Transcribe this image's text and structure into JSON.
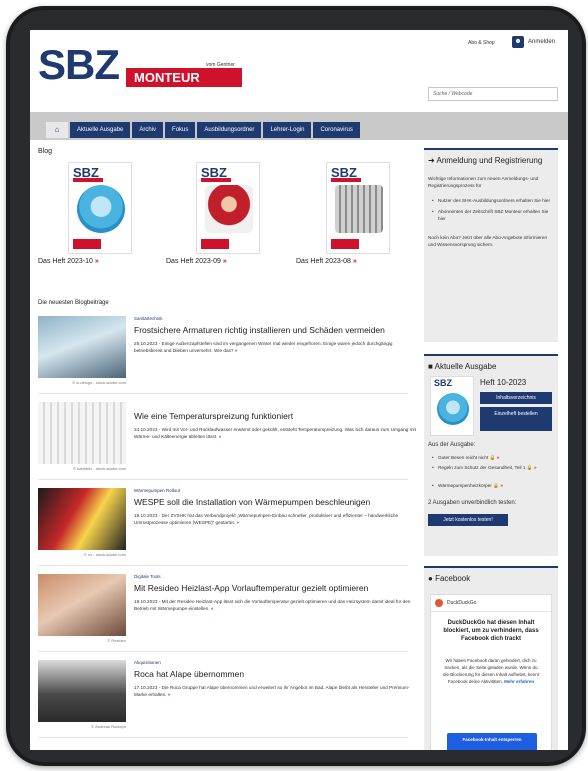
{
  "header": {
    "logo": "SBZ",
    "logo_bar": "MONTEUR",
    "logo_sub": "vom Gentner",
    "abo_shop": "Abo & Shop",
    "login_label": "Anmelden",
    "search_placeholder": "Suche / Webcode"
  },
  "nav": {
    "items": [
      "Aktuelle Ausgabe",
      "Archiv",
      "Fokus",
      "Ausbildungsordner",
      "Lehrer-Login",
      "Coronavirus"
    ]
  },
  "main": {
    "blog_title": "Blog",
    "hefte": [
      {
        "label": "Das Heft 2023-10"
      },
      {
        "label": "Das Heft 2023-09"
      },
      {
        "label": "Das Heft 2023-08"
      }
    ],
    "posts_heading": "Die neuesten Blogbeiträge",
    "posts": [
      {
        "category": "Sanitärtechnik",
        "title": "Frostsichere Armaturen richtig installieren und Schäden vermeiden",
        "text": "25.10.2023 - Einige Außenzapfstellen sind im vergangenen Winter mal wieder eingefroren. Einige waren jedoch durchgängig betriebsbereit und blieben unversehrt. Wie das?",
        "credit": "© ic-design - stock.adobe.com"
      },
      {
        "category": "",
        "title": "Wie eine Temperaturspreizung funktioniert",
        "text": "24.10.2023 - Wird mit Vor- und Rücklaufwasser erwärmt oder gekühlt, entsteht Temperaturspreizung. Was sich daraus zum Umgang mit Wärme- und Kälteenergie ableiten lässt.",
        "credit": "© hansfritz - stock.adobe.com"
      },
      {
        "category": "Wärmepumpen Rollout",
        "title": "WESPE soll die Installation von Wärmepumpen beschleunigen",
        "text": "19.10.2023 - Der ZVSHK hat das Verbundprojekt „Wärmepumpen-Einbau schneller, produktiver und effizienter – handwerkliche Umrüstprozesse optimieren (WESPE)“ gestartet.",
        "credit": "© nz - stock.adobe.com"
      },
      {
        "category": "Digitale Tools",
        "title": "Mit Resideo Heizlast-App Vorlauftemperatur gezielt optimieren",
        "text": "19.10.2023 - Mit der Resideo Heizlast-App lässt sich die Vorlauftemperatur gezielt optimieren und das Heizsystem damit ideal für den Betrieb mit Wärmepumpe einstellen.",
        "credit": "© Resideo"
      },
      {
        "category": "Akquisitionen",
        "title": "Roca hat Alape übernommen",
        "text": "17.10.2023 - Die Roca Gruppe hat Alape übernommen und erweitert so ihr Angebot im Bad. Alape bleibt als Hersteller und Premium-Marke erhalten.",
        "credit": "© Andreas Rudolph"
      }
    ]
  },
  "sidebar": {
    "anmeldung": {
      "title": "Anmeldung und Registrierung",
      "intro": "Wichtige Informationen zum neuen Anmeldungs- und Registrierungsprozess für",
      "bullet1": "Nutzer des SHK-Ausbildungsordners erhalten Sie hier",
      "bullet2": "Abonnenten der Zeitschrift SBZ Monteur erhalten Sie hier",
      "outro": "Noch kein Abo? Jetzt über alle Abo-Angebote informieren und Wissensvorsprung sichern."
    },
    "ausgabe": {
      "title": "Aktuelle Ausgabe",
      "heft": "Heft 10-2023",
      "btn_toc": "Inhaltsverzeichnis",
      "btn_order": "Einzelheft bestellen",
      "aus_label": "Aus der Ausgabe:",
      "items": [
        "Guter Besen reicht nicht",
        "Regeln zum Schutz der Gesundheit, Teil 1",
        "Wärmepumpenheizkörper"
      ],
      "test_text": "2 Ausgaben unverbindlich testen:",
      "test_btn": "Jetzt kostenlos testen!"
    },
    "facebook": {
      "title": "Facebook",
      "ddg": "DuckDuckGo",
      "blocked_title": "DuckDuckGo hat diesen Inhalt blockiert, um zu verhindern, dass Facebook dich trackt",
      "blocked_text": "Wir haben Facebook daran gehindert, dich zu tracken, als die Seite geladen wurde. Wenn du die Blockierung für diesen Inhalt aufhebst, kennt Facebook deine Aktivitäten.",
      "more": "Mehr erfahren",
      "unblock_btn": "Facebook-Inhalt entsperren"
    }
  }
}
